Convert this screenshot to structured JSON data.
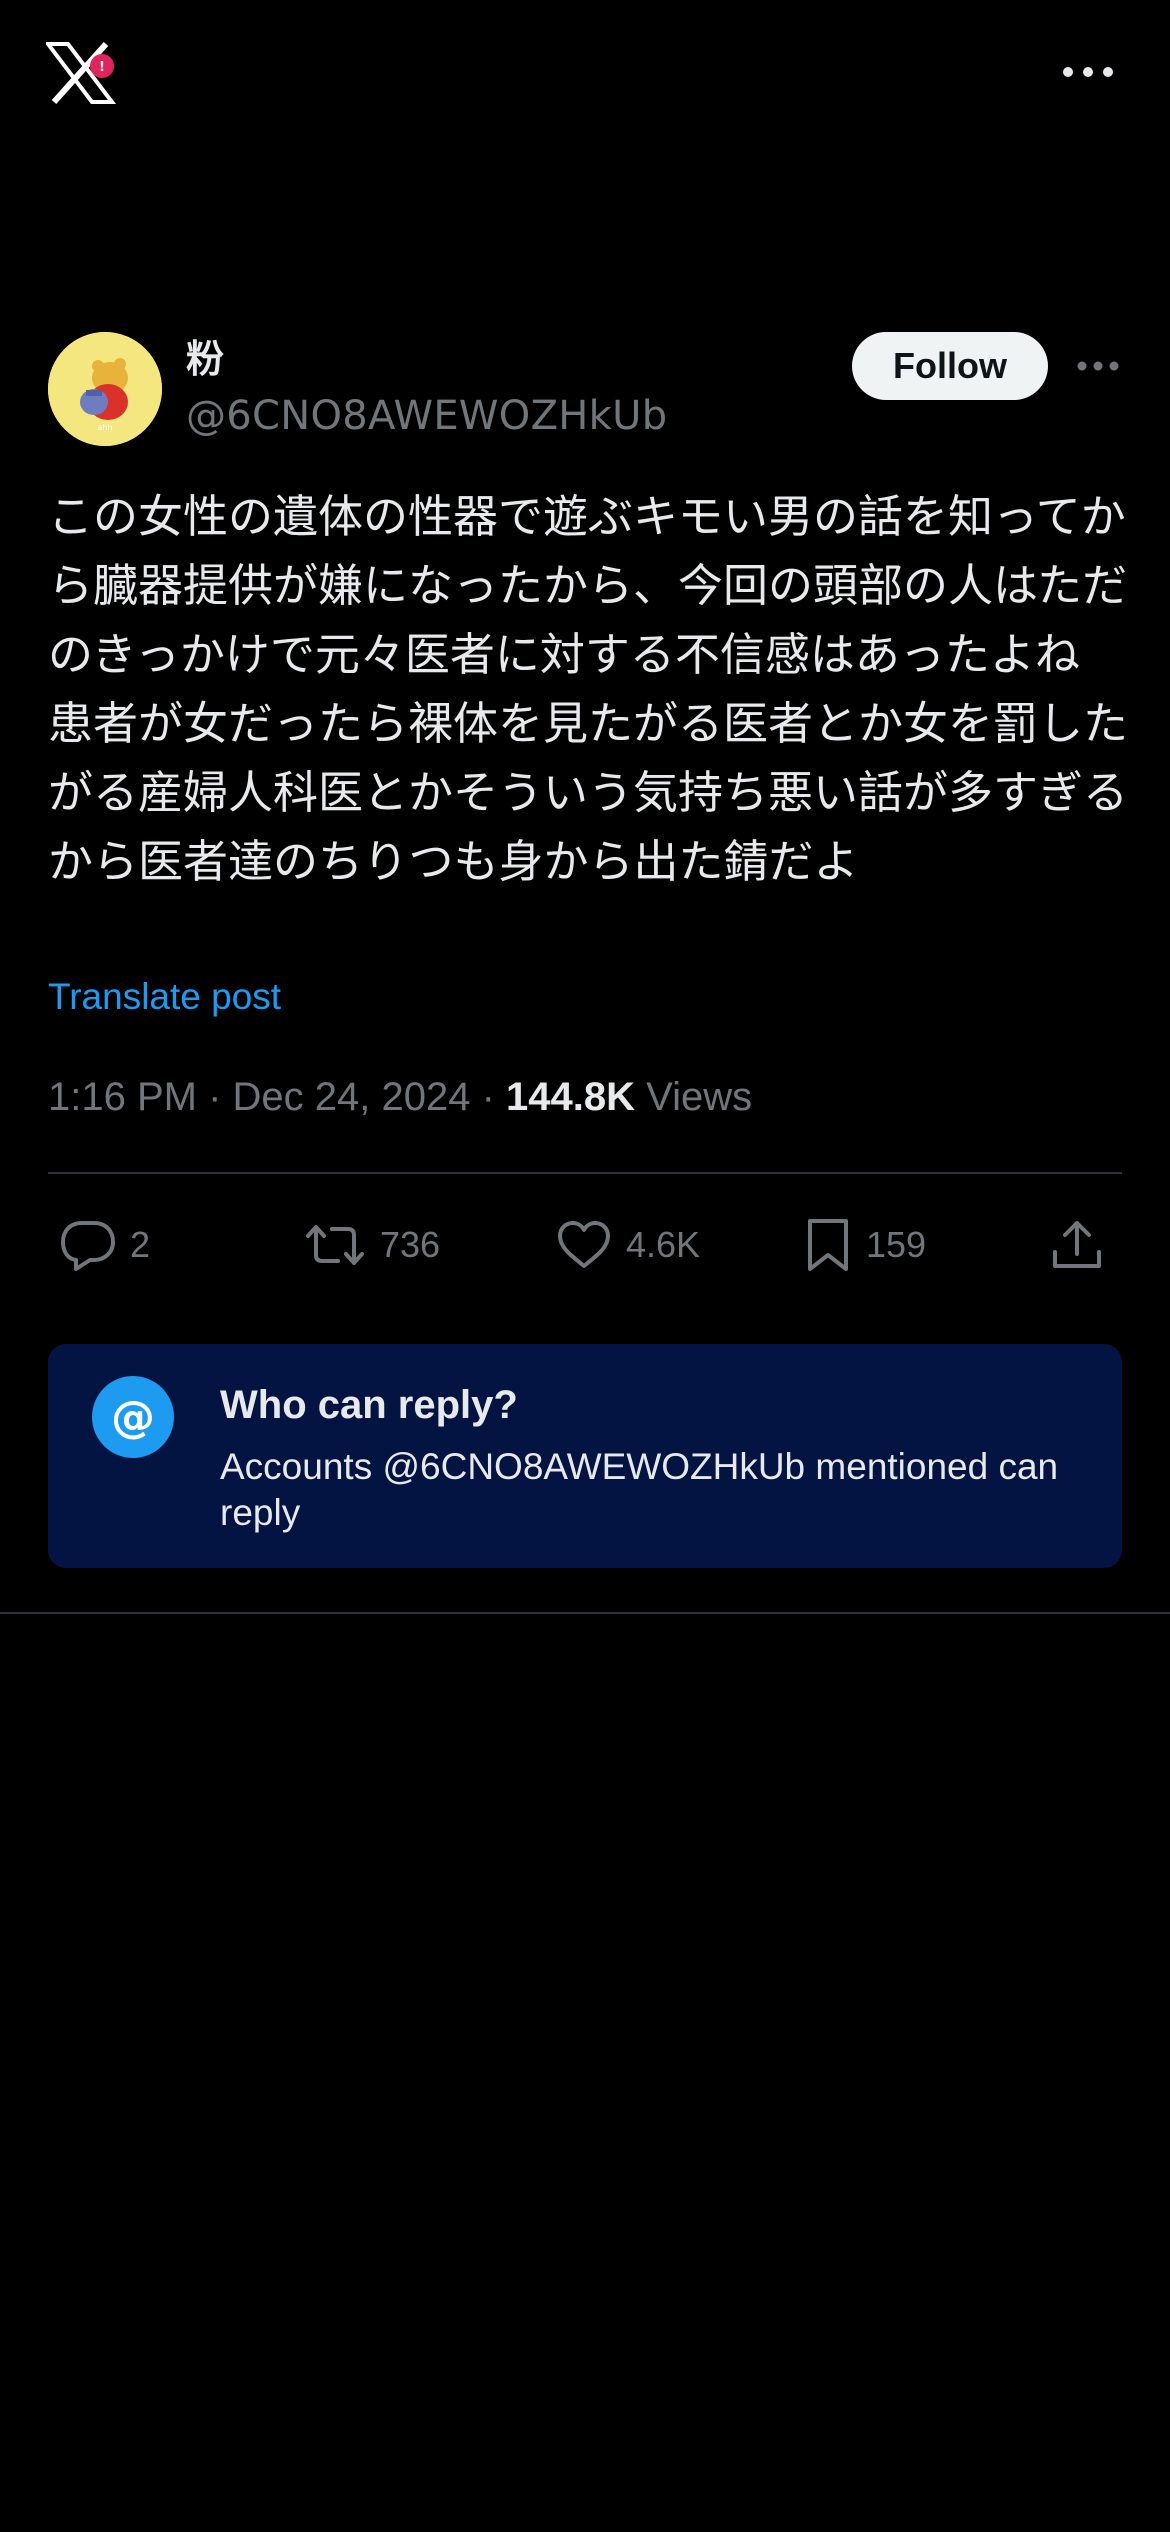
{
  "app": {
    "logo_icon": "x-logo-icon",
    "badge_icon": "notification-badge-icon"
  },
  "post": {
    "author": {
      "display_name": "粉",
      "handle": "@6CNO8AWEWOZHkUb",
      "avatar_icon": "winnie-the-pooh-avatar"
    },
    "follow_label": "Follow",
    "text": "この女性の遺体の性器で遊ぶキモい男の話を知ってから臓器提供が嫌になったから、今回の頭部の人はただのきっかけで元々医者に対する不信感はあったよね 患者が女だったら裸体を見たがる医者とか女を罰したがる産婦人科医とかそういう気持ち悪い話が多すぎるから医者達のちりつも身から出た錆だよ",
    "translate_label": "Translate post",
    "meta": {
      "time": "1:16 PM",
      "separator1": " · ",
      "date": "Dec 24, 2024",
      "separator2": " · ",
      "views_count": "144.8K",
      "views_label": " Views"
    },
    "actions": {
      "replies": "2",
      "reposts": "736",
      "likes": "4.6K",
      "bookmarks": "159"
    }
  },
  "reply_restriction": {
    "icon": "@",
    "title": "Who can reply?",
    "description": "Accounts @6CNO8AWEWOZHkUb mentioned can reply"
  },
  "colors": {
    "background": "#000000",
    "text_primary": "#e7e9ea",
    "text_secondary": "#71767b",
    "accent": "#1d9bf0",
    "reply_box_bg": "#041442",
    "follow_bg": "#eff3f4"
  }
}
